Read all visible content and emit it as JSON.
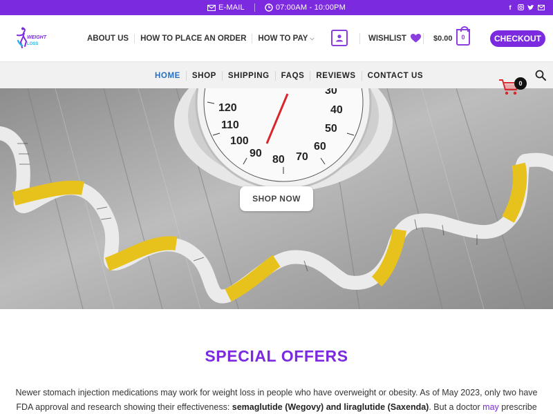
{
  "topbar": {
    "email_label": "E-MAIL",
    "hours_label": "07:00AM - 10:00PM",
    "social_icons": [
      "facebook-icon",
      "instagram-icon",
      "twitter-icon",
      "mail-icon"
    ]
  },
  "logo": {
    "line1": "WEIGHT",
    "line2": "LOSS"
  },
  "nav": {
    "items": [
      "ABOUT US",
      "HOW TO PLACE AN ORDER",
      "HOW TO PAY"
    ]
  },
  "header": {
    "wishlist_label": "WISHLIST",
    "cart_total": "$0.00",
    "cart_count": "0",
    "checkout_label": "CHECKOUT"
  },
  "subnav": {
    "items": [
      "HOME",
      "SHOP",
      "SHIPPING",
      "FAQS",
      "REVIEWS",
      "CONTACT US"
    ],
    "active": "HOME"
  },
  "hero": {
    "button_label": "SHOP NOW",
    "floating_cart_count": "0"
  },
  "offers": {
    "title": "SPECIAL OFFERS",
    "para_part1": "Newer stomach injection medications may work for weight loss in people who have overweight or obesity. As of May 2023, only two have FDA approval and research showing their effectiveness: ",
    "para_bold": "semaglutide (Wegovy) and liraglutide (Saxenda)",
    "para_part2": ". But a doctor ",
    "para_link": "may",
    "para_part3": " prescribe other options off"
  },
  "colors": {
    "brand_purple": "#7c2ae0",
    "active_blue": "#2a6fbf"
  }
}
